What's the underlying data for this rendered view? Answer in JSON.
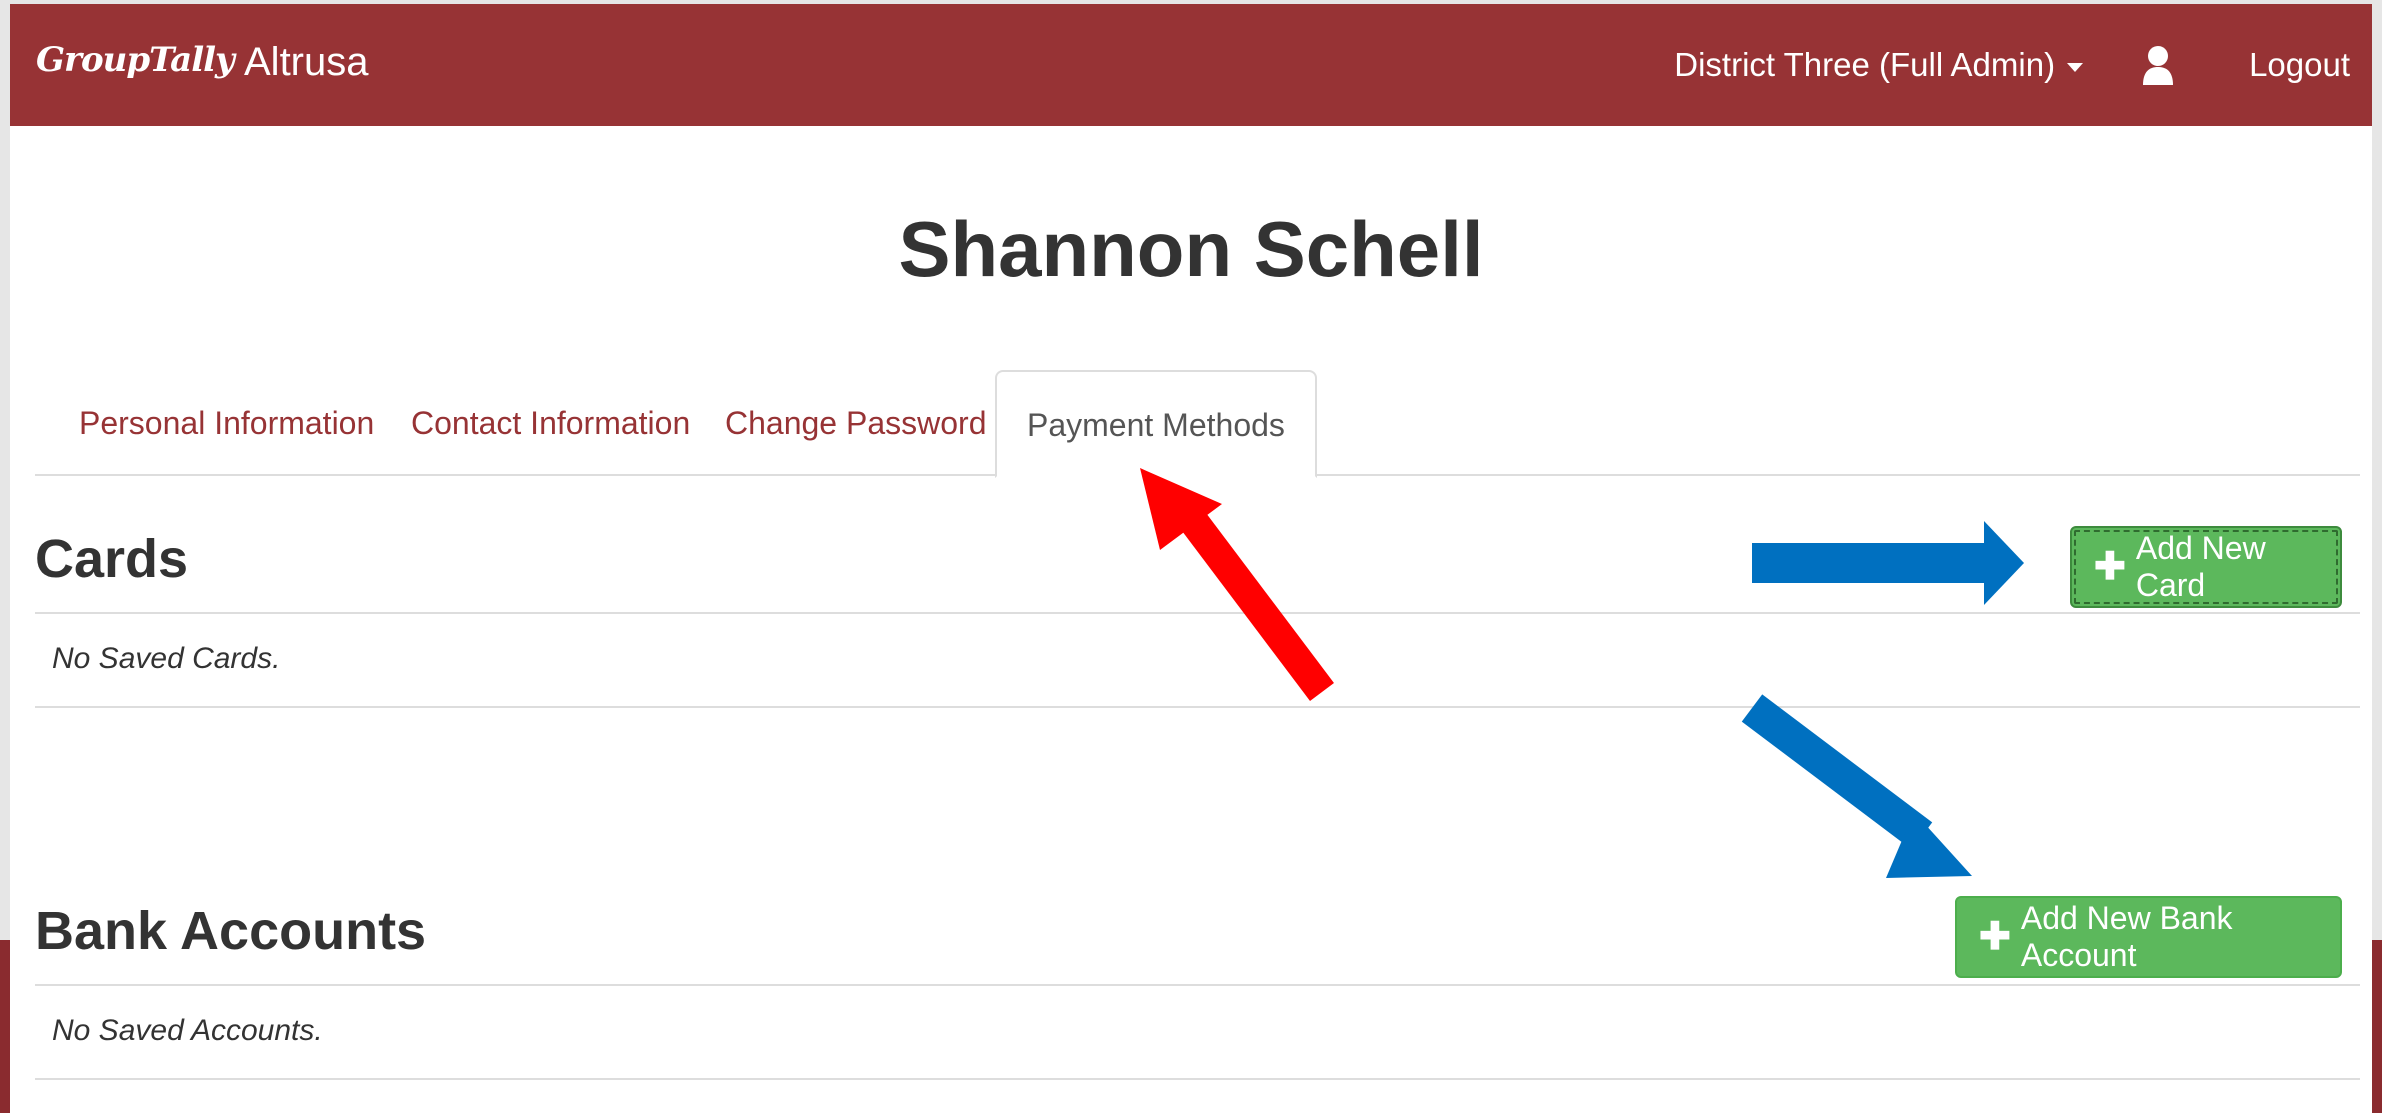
{
  "navbar": {
    "brand": "GroupTally",
    "org": "Altrusa",
    "account_menu_label": "District Three (Full Admin)",
    "account_menu_icon": "chevron-down-icon",
    "user_icon": "user-icon",
    "logout_label": "Logout",
    "color": "#973335"
  },
  "page": {
    "title": "Shannon Schell"
  },
  "tabs": [
    {
      "label": "Personal Information",
      "active": false
    },
    {
      "label": "Contact Information",
      "active": false
    },
    {
      "label": "Change Password",
      "active": false
    },
    {
      "label": "Payment Methods",
      "active": true
    }
  ],
  "cards": {
    "heading": "Cards",
    "empty_text": "No Saved Cards.",
    "add_button_label": "Add New Card",
    "add_button_icon": "plus-icon"
  },
  "bank_accounts": {
    "heading": "Bank Accounts",
    "empty_text": "No Saved Accounts.",
    "add_button_label": "Add New Bank Account",
    "add_button_icon": "plus-icon"
  },
  "colors": {
    "success": "#5cb85c",
    "annotation_red": "#ff0000",
    "annotation_blue": "#0070c0"
  }
}
